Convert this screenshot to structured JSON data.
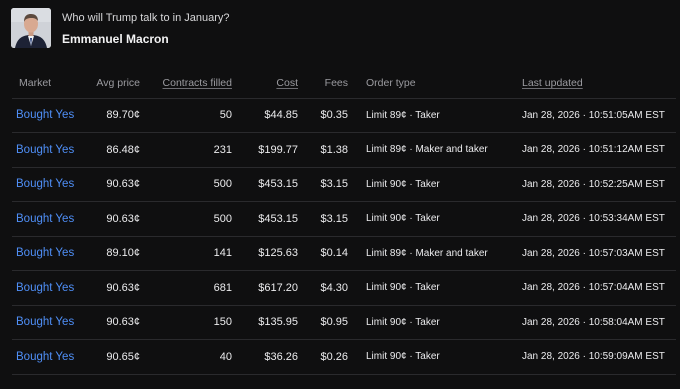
{
  "header": {
    "question": "Who will Trump talk to in January?",
    "answer": "Emmanuel Macron"
  },
  "colors": {
    "link": "#4f8ff7",
    "background": "#0f0f10",
    "divider": "#2a2a2d"
  },
  "table": {
    "columns": {
      "market": "Market",
      "avg_price": "Avg price",
      "contracts": "Contracts filled",
      "cost": "Cost",
      "fees": "Fees",
      "order_type": "Order type",
      "last_updated": "Last updated"
    },
    "rows": [
      {
        "market": "Bought Yes",
        "avg_price": "89.70¢",
        "contracts": "50",
        "cost": "$44.85",
        "fees": "$0.35",
        "order_type": "Limit 89¢ · Taker",
        "last_updated": "Jan 28, 2026 · 10:51:05AM EST"
      },
      {
        "market": "Bought Yes",
        "avg_price": "86.48¢",
        "contracts": "231",
        "cost": "$199.77",
        "fees": "$1.38",
        "order_type": "Limit 89¢ · Maker and taker",
        "last_updated": "Jan 28, 2026 · 10:51:12AM EST"
      },
      {
        "market": "Bought Yes",
        "avg_price": "90.63¢",
        "contracts": "500",
        "cost": "$453.15",
        "fees": "$3.15",
        "order_type": "Limit 90¢ · Taker",
        "last_updated": "Jan 28, 2026 · 10:52:25AM EST"
      },
      {
        "market": "Bought Yes",
        "avg_price": "90.63¢",
        "contracts": "500",
        "cost": "$453.15",
        "fees": "$3.15",
        "order_type": "Limit 90¢ · Taker",
        "last_updated": "Jan 28, 2026 · 10:53:34AM EST"
      },
      {
        "market": "Bought Yes",
        "avg_price": "89.10¢",
        "contracts": "141",
        "cost": "$125.63",
        "fees": "$0.14",
        "order_type": "Limit 89¢ · Maker and taker",
        "last_updated": "Jan 28, 2026 · 10:57:03AM EST"
      },
      {
        "market": "Bought Yes",
        "avg_price": "90.63¢",
        "contracts": "681",
        "cost": "$617.20",
        "fees": "$4.30",
        "order_type": "Limit 90¢ · Taker",
        "last_updated": "Jan 28, 2026 · 10:57:04AM EST"
      },
      {
        "market": "Bought Yes",
        "avg_price": "90.63¢",
        "contracts": "150",
        "cost": "$135.95",
        "fees": "$0.95",
        "order_type": "Limit 90¢ · Taker",
        "last_updated": "Jan 28, 2026 · 10:58:04AM EST"
      },
      {
        "market": "Bought Yes",
        "avg_price": "90.65¢",
        "contracts": "40",
        "cost": "$36.26",
        "fees": "$0.26",
        "order_type": "Limit 90¢ · Taker",
        "last_updated": "Jan 28, 2026 · 10:59:09AM EST"
      }
    ]
  }
}
